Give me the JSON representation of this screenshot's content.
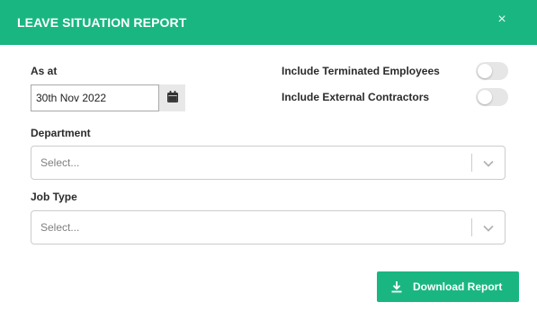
{
  "dialog": {
    "title": "LEAVE SITUATION REPORT",
    "close_glyph": "×"
  },
  "as_at": {
    "label": "As at",
    "value": "30th Nov 2022",
    "calendar_icon": "calendar-icon"
  },
  "toggles": [
    {
      "label": "Include Terminated Employees",
      "on": false
    },
    {
      "label": "Include External Contractors",
      "on": false
    }
  ],
  "department": {
    "label": "Department",
    "placeholder": "Select..."
  },
  "job_type": {
    "label": "Job Type",
    "placeholder": "Select..."
  },
  "download": {
    "label": "Download Report",
    "icon": "download-icon"
  },
  "colors": {
    "accent": "#1ab682",
    "toggle_off": "#e6e6e6"
  }
}
